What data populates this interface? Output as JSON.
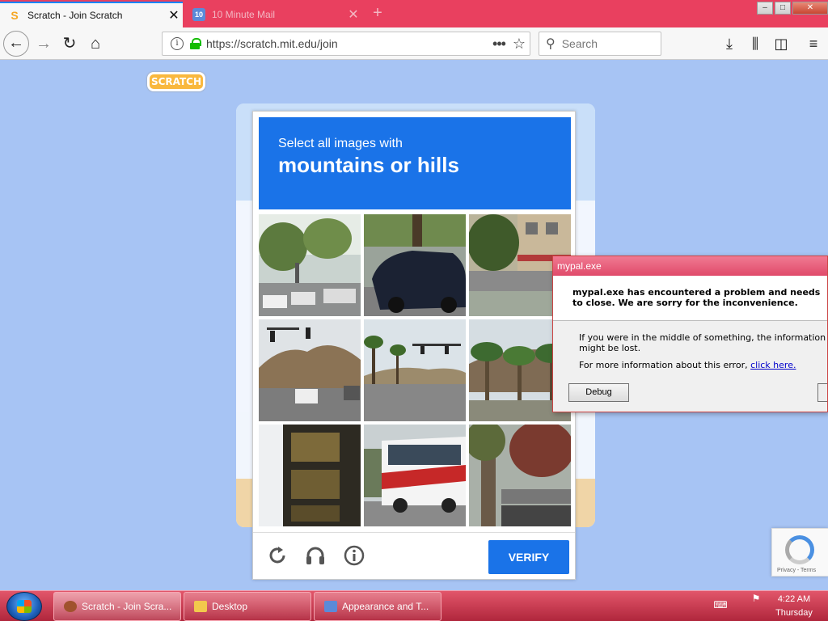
{
  "browser": {
    "tabs": [
      {
        "title": "Scratch - Join Scratch",
        "favicon": "S",
        "active": true
      },
      {
        "title": "10 Minute Mail",
        "favicon": "10",
        "active": false
      }
    ],
    "new_tab": "+",
    "url": "https://scratch.mit.edu/join",
    "search_placeholder": "Search",
    "window_buttons": {
      "minimize": "–",
      "maximize": "□",
      "close": "✕"
    }
  },
  "page": {
    "logo_text": "SCRATCH"
  },
  "captcha": {
    "header_line1": "Select all images with",
    "header_line2": "mountains or hills",
    "verify_label": "VERIFY",
    "header_color": "#1a73e8"
  },
  "dialog": {
    "title": "mypal.exe",
    "headline": "mypal.exe has encountered a problem and needs to close.  We are sorry for the inconvenience.",
    "body_line1": "If you were in the middle of something, the information you were w",
    "body_line2": "might be lost.",
    "more_info_prefix": "For more information about this error, ",
    "more_info_link": "click here.",
    "debug_label": "Debug"
  },
  "recaptcha_badge": {
    "terms": "Privacy - Terms"
  },
  "taskbar": {
    "items": [
      {
        "label": "Scratch - Join Scra..."
      },
      {
        "label": "Desktop"
      },
      {
        "label": "Appearance and T..."
      }
    ],
    "clock_time": "4:22 AM",
    "clock_day": "Thursday"
  }
}
